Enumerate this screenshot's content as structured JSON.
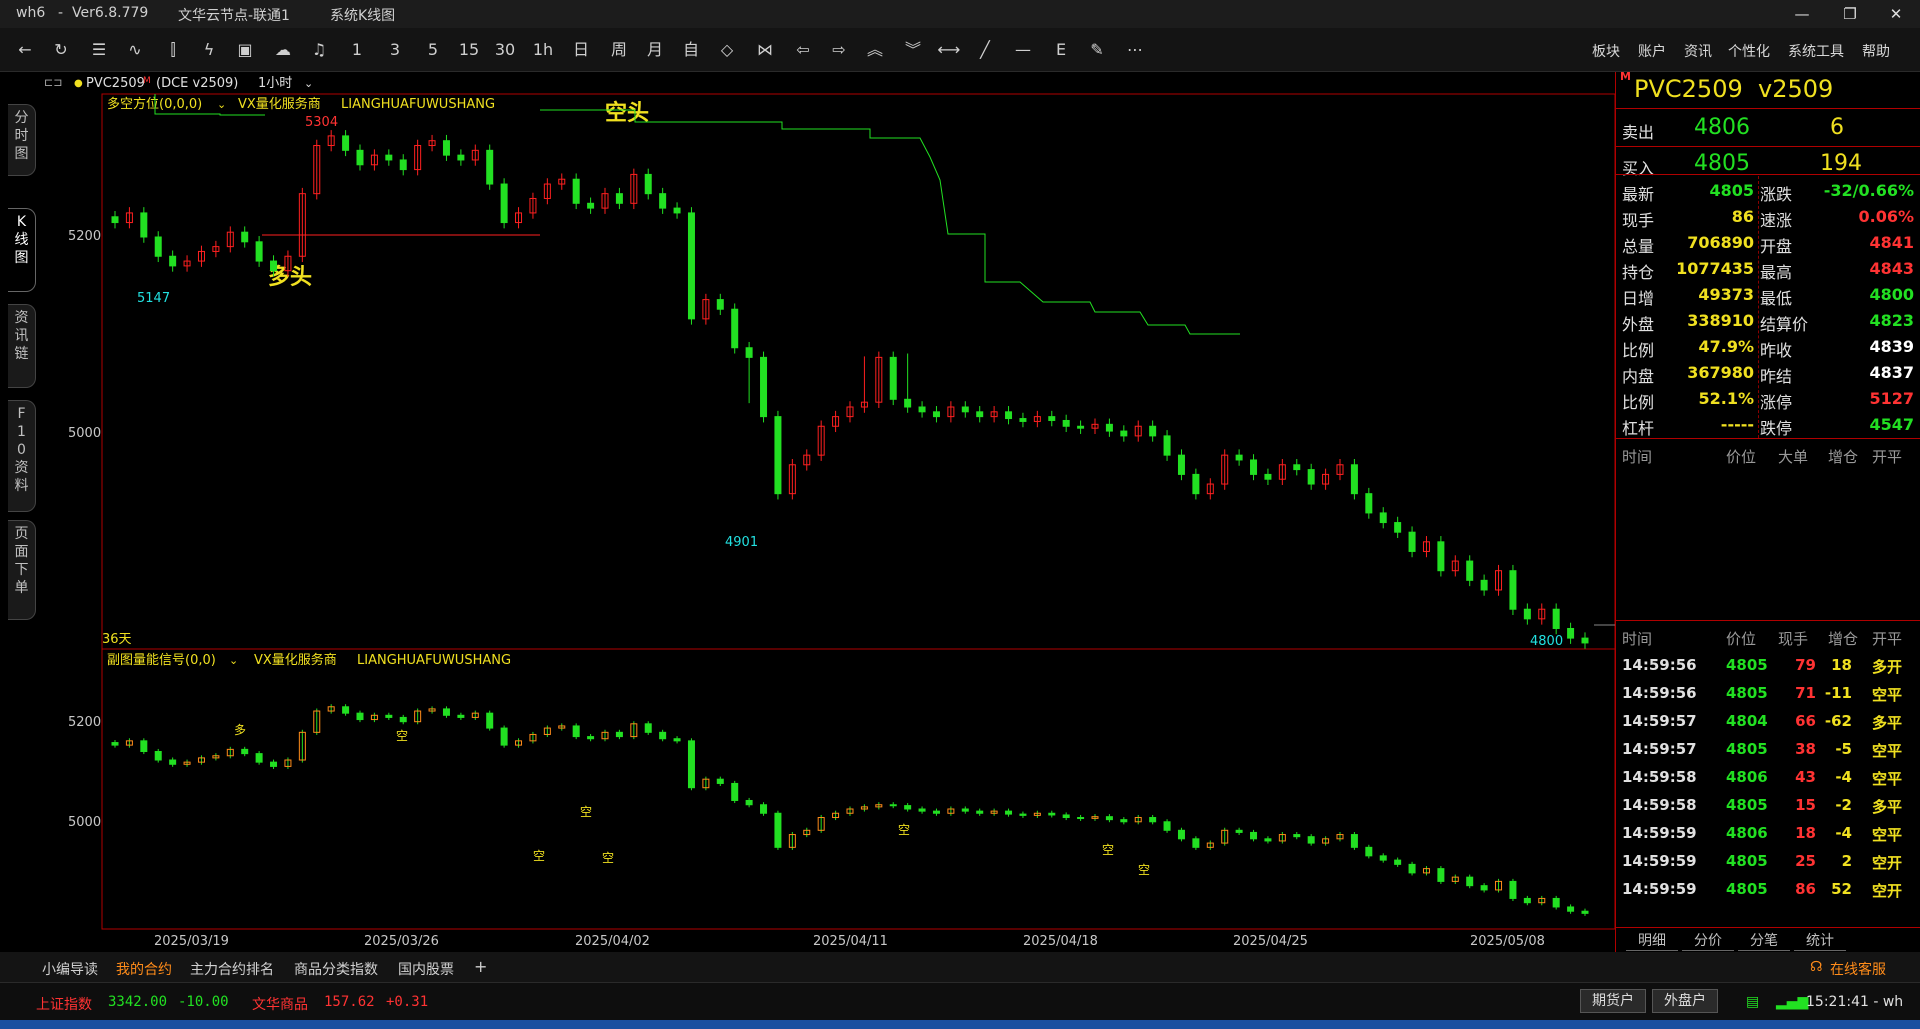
{
  "window": {
    "app": "wh6",
    "separator": "-",
    "version": "Ver6.8.779",
    "node": "文华云节点-联通1",
    "view": "系统K线图",
    "minimize": "—",
    "restore": "❐",
    "close": "✕"
  },
  "toolbar": {
    "periods": [
      "1",
      "3",
      "5",
      "15",
      "30",
      "1h",
      "日",
      "周",
      "月"
    ],
    "menus": [
      "板块",
      "账户",
      "资讯",
      "个性化",
      "系统工具",
      "帮助"
    ],
    "more": "⋯"
  },
  "sidetabs": [
    "分时图",
    "K线图",
    "资讯链",
    "F10资料",
    "页面下单"
  ],
  "chart_header": {
    "symbol": "PVC2509",
    "badge": "M",
    "exchange": "(DCE v2509)",
    "period": "1小时"
  },
  "main_panel": {
    "indicator": "多空方位(0,0,0)",
    "vendor": "VX量化服务商",
    "vendor_code": "LIANGHUAFUWUSHANG",
    "label_short": "空头",
    "label_long": "多头",
    "high_label": "5304",
    "low_label_1": "5147",
    "low_label_2": "4901",
    "last_label": "4800",
    "days_label": "36天",
    "yticks": [
      "5200",
      "5000"
    ]
  },
  "sub_panel": {
    "indicator": "副图量能信号(0,0)",
    "vendor": "VX量化服务商",
    "vendor_code": "LIANGHUAFUWUSHANG",
    "yticks": [
      "5200",
      "5000"
    ],
    "signal_long": "多",
    "signal_short": "空"
  },
  "xaxis": [
    "2025/03/19",
    "2025/03/26",
    "2025/04/02",
    "2025/04/11",
    "2025/04/18",
    "2025/04/25",
    "2025/05/08"
  ],
  "quote": {
    "badge": "M",
    "title": "PVC2509  v2509",
    "ask_label": "卖出",
    "ask_price": "4806",
    "ask_vol": "6",
    "bid_label": "买入",
    "bid_price": "4805",
    "bid_vol": "194",
    "fields": [
      {
        "l1": "最新",
        "v1": "4805",
        "c1": "#22e022",
        "l2": "涨跌",
        "v2": "-32/0.66%",
        "c2": "#22e022"
      },
      {
        "l1": "现手",
        "v1": "86",
        "c1": "#f0e020",
        "l2": "速涨",
        "v2": "0.06%",
        "c2": "#ff3333"
      },
      {
        "l1": "总量",
        "v1": "706890",
        "c1": "#f0e020",
        "l2": "开盘",
        "v2": "4841",
        "c2": "#ff3333"
      },
      {
        "l1": "持仓",
        "v1": "1077435",
        "c1": "#f0e020",
        "l2": "最高",
        "v2": "4843",
        "c2": "#ff3333"
      },
      {
        "l1": "日增",
        "v1": "49373",
        "c1": "#f0e020",
        "l2": "最低",
        "v2": "4800",
        "c2": "#22e022"
      },
      {
        "l1": "外盘",
        "v1": "338910",
        "c1": "#f0e020",
        "l2": "结算价",
        "v2": "4823",
        "c2": "#22e022"
      },
      {
        "l1": "比例",
        "v1": "47.9%",
        "c1": "#f0e020",
        "l2": "昨收",
        "v2": "4839",
        "c2": "#ffffff"
      },
      {
        "l1": "内盘",
        "v1": "367980",
        "c1": "#f0e020",
        "l2": "昨结",
        "v2": "4837",
        "c2": "#ffffff"
      },
      {
        "l1": "比例",
        "v1": "52.1%",
        "c1": "#f0e020",
        "l2": "涨停",
        "v2": "5127",
        "c2": "#ff3333"
      },
      {
        "l1": "杠杆",
        "v1": "-----",
        "c1": "#f0e020",
        "l2": "跌停",
        "v2": "4547",
        "c2": "#22e022"
      }
    ],
    "large_head": [
      "时间",
      "价位",
      "大单",
      "增仓",
      "开平"
    ],
    "ticks_head": [
      "时间",
      "价位",
      "现手",
      "增仓",
      "开平"
    ],
    "ticks": [
      {
        "t": "14:59:56",
        "p": "4805",
        "v": "79",
        "d": "18",
        "k": "多开"
      },
      {
        "t": "14:59:56",
        "p": "4805",
        "v": "71",
        "d": "-11",
        "k": "空平"
      },
      {
        "t": "14:59:57",
        "p": "4804",
        "v": "66",
        "d": "-62",
        "k": "多平"
      },
      {
        "t": "14:59:57",
        "p": "4805",
        "v": "38",
        "d": "-5",
        "k": "空平"
      },
      {
        "t": "14:59:58",
        "p": "4806",
        "v": "43",
        "d": "-4",
        "k": "空平"
      },
      {
        "t": "14:59:58",
        "p": "4805",
        "v": "15",
        "d": "-2",
        "k": "多平"
      },
      {
        "t": "14:59:59",
        "p": "4806",
        "v": "18",
        "d": "-4",
        "k": "空平"
      },
      {
        "t": "14:59:59",
        "p": "4805",
        "v": "25",
        "d": "2",
        "k": "空开"
      },
      {
        "t": "14:59:59",
        "p": "4805",
        "v": "86",
        "d": "52",
        "k": "空开"
      }
    ],
    "tabs": [
      "明细",
      "分价",
      "分笔",
      "统计"
    ]
  },
  "bottom_tabs": [
    "小编导读",
    "我的合约",
    "主力合约排名",
    "商品分类指数",
    "国内股票"
  ],
  "bottom_add": "+",
  "service": "在线客服",
  "status": {
    "idx1_name": "上证指数",
    "idx1_val": "3342.00",
    "idx1_chg": "-10.00",
    "idx2_name": "文华商品",
    "idx2_val": "157.62",
    "idx2_chg": "+0.31",
    "btn1": "期货户",
    "btn2": "外盘户",
    "time": "15:21:41 - wh"
  },
  "chart_data": {
    "type": "candlestick",
    "title": "PVC2509",
    "period": "1小时",
    "xlabels": [
      "2025/03/19",
      "2025/03/26",
      "2025/04/02",
      "2025/04/11",
      "2025/04/18",
      "2025/04/25",
      "2025/05/08"
    ],
    "ylim": [
      4780,
      5320
    ],
    "yticks": [
      5200,
      5000
    ],
    "high": 5304,
    "low": 4800,
    "annotations": [
      "5304",
      "5147",
      "4901",
      "4800"
    ],
    "close_path": [
      5200,
      5210,
      5185,
      5165,
      5155,
      5160,
      5170,
      5175,
      5190,
      5180,
      5160,
      5150,
      5165,
      5230,
      5280,
      5290,
      5275,
      5260,
      5270,
      5265,
      5255,
      5280,
      5285,
      5270,
      5265,
      5275,
      5240,
      5200,
      5210,
      5225,
      5240,
      5245,
      5220,
      5215,
      5230,
      5220,
      5250,
      5230,
      5215,
      5210,
      5100,
      5120,
      5110,
      5070,
      5060,
      5040,
      4960,
      4990,
      5000,
      5030,
      5040,
      5050,
      5055,
      5060,
      5058,
      5050,
      5045,
      5040,
      5050,
      5045,
      5040,
      5045,
      5038,
      5035,
      5040,
      5036,
      5030,
      5028,
      5032,
      5025,
      5020,
      5030,
      5020,
      5000,
      4980,
      4960,
      4970,
      5000,
      4995,
      4980,
      4975,
      4990,
      4985,
      4970,
      4980,
      4990,
      4960,
      4940,
      4930,
      4920,
      4900,
      4910,
      4880,
      4890,
      4870,
      4860,
      4880,
      4840,
      4830,
      4840,
      4820,
      4810,
      4805
    ],
    "ls_upper": [
      {
        "x": 2025.0319,
        "y": 5300
      },
      {
        "x": 2025.0402,
        "y": 5290
      },
      {
        "x": 2025.0408,
        "y": 5270
      }
    ],
    "ls_lower": [
      {
        "x": 2025.0321,
        "y": 5155
      },
      {
        "x": 2025.0402,
        "y": 5157
      }
    ]
  }
}
